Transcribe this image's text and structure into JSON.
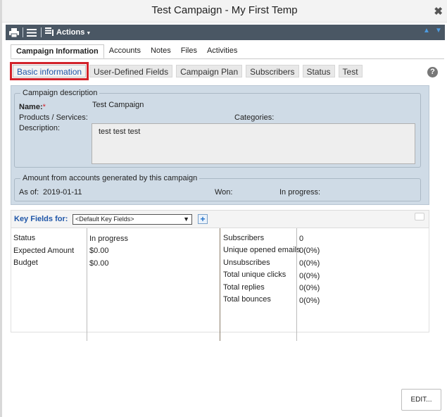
{
  "window": {
    "title": "Test Campaign - My First Temp",
    "close_glyph": "✖"
  },
  "toolbar": {
    "actions_label": "Actions",
    "icons": [
      "print-icon",
      "list-icon",
      "actions-icon",
      "arrow-up-icon",
      "arrow-down-icon"
    ]
  },
  "tabs": [
    "Campaign Information",
    "Accounts",
    "Notes",
    "Files",
    "Activities"
  ],
  "subtabs": [
    "Basic information",
    "User-Defined Fields",
    "Campaign Plan",
    "Subscribers",
    "Status",
    "Test"
  ],
  "help_glyph": "?",
  "campaign_description": {
    "legend": "Campaign description",
    "name_label": "Name:",
    "required_mark": "*",
    "name_value": "Test Campaign",
    "products_label": "Products / Services:",
    "categories_label": "Categories:",
    "description_label": "Description:",
    "description_value": "test test test"
  },
  "amount": {
    "legend": "Amount from accounts generated by this campaign",
    "as_of_label": "As of:",
    "as_of_value": "2019-01-11",
    "won_label": "Won:",
    "in_progress_label": "In progress:"
  },
  "key_fields": {
    "label": "Key Fields for:",
    "select_value": "<Default Key Fields>",
    "plus_glyph": "+",
    "left_rows": [
      {
        "label": "Status",
        "value": "In progress"
      },
      {
        "label": "Expected Amount",
        "value": "$0.00"
      },
      {
        "label": "Budget",
        "value": "$0.00"
      }
    ],
    "right_rows": [
      {
        "label": "Subscribers",
        "value": "0"
      },
      {
        "label": "Unique opened emails",
        "value": "0(0%)"
      },
      {
        "label": "Unsubscribes",
        "value": "0(0%)"
      },
      {
        "label": "Total unique clicks",
        "value": "0(0%)"
      },
      {
        "label": "Total replies",
        "value": "0(0%)"
      },
      {
        "label": "Total bounces",
        "value": "0(0%)"
      }
    ]
  },
  "edit_button": "EDIT...",
  "colors": {
    "toolbar_bg": "#4a5764",
    "panel_bg": "#cfdbe6",
    "accent_blue": "#1f56a8",
    "highlight_red": "#d2222a"
  }
}
